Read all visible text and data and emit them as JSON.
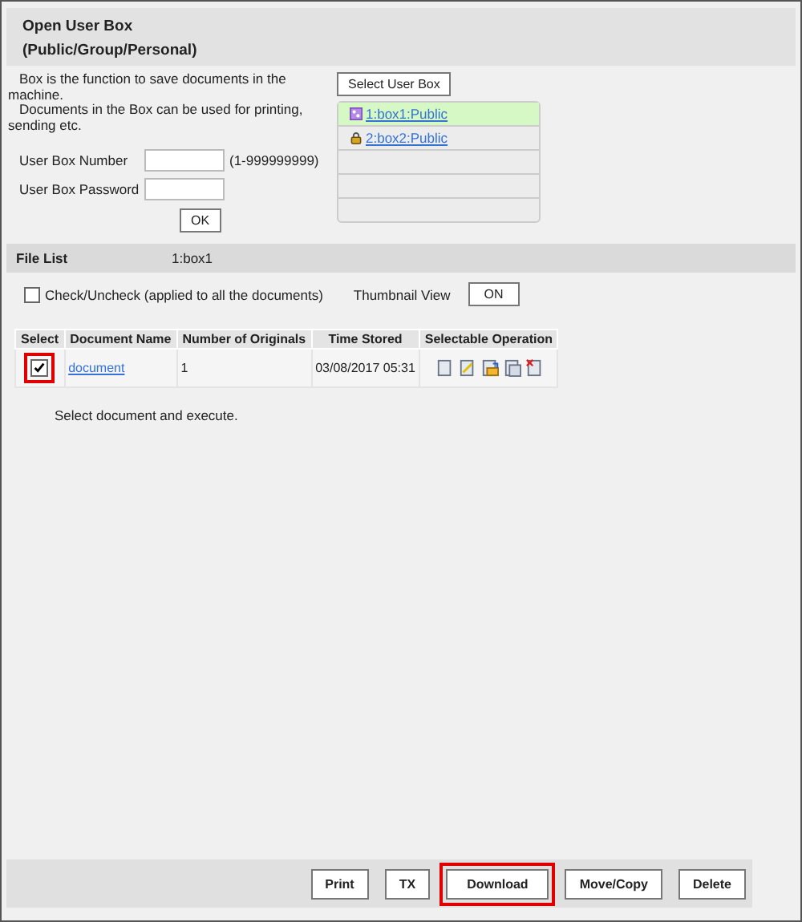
{
  "title": "Open User Box",
  "subtitle": "(Public/Group/Personal)",
  "description": [
    "Box is the function to save documents in the machine.",
    "Documents in the Box can be used for printing, sending etc."
  ],
  "fields": [
    {
      "label": "User Box Number",
      "hint": "(1-999999999)"
    },
    {
      "label": "User Box Password"
    }
  ],
  "ok_button": "OK",
  "select_box_button": "Select User Box",
  "boxes": [
    {
      "label": "1:box1:Public",
      "kind": "group",
      "selected": true
    },
    {
      "label": "2:box2:Public",
      "kind": "lock",
      "selected": false
    }
  ],
  "file_list": {
    "label": "File List",
    "box": "1:box1"
  },
  "check_all": {
    "label": "Check/Uncheck (applied to all the documents)",
    "checked": false
  },
  "thumbnail": {
    "label": "Thumbnail View",
    "button": "ON"
  },
  "table": {
    "columns": [
      "Select",
      "Document Name",
      "Number of Originals",
      "Time Stored",
      "Selectable Operation"
    ],
    "rows": [
      {
        "checked": true,
        "highlighted": true,
        "name": "document",
        "originals": "1",
        "time": "03/08/2017 05:31"
      }
    ]
  },
  "instruction": "Select document and execute.",
  "buttons": [
    {
      "label": "Print",
      "highlighted": false
    },
    {
      "label": "TX",
      "highlighted": false
    },
    {
      "label": "Download",
      "highlighted": true
    },
    {
      "label": "Move/Copy",
      "highlighted": false
    },
    {
      "label": "Delete",
      "highlighted": false
    }
  ]
}
